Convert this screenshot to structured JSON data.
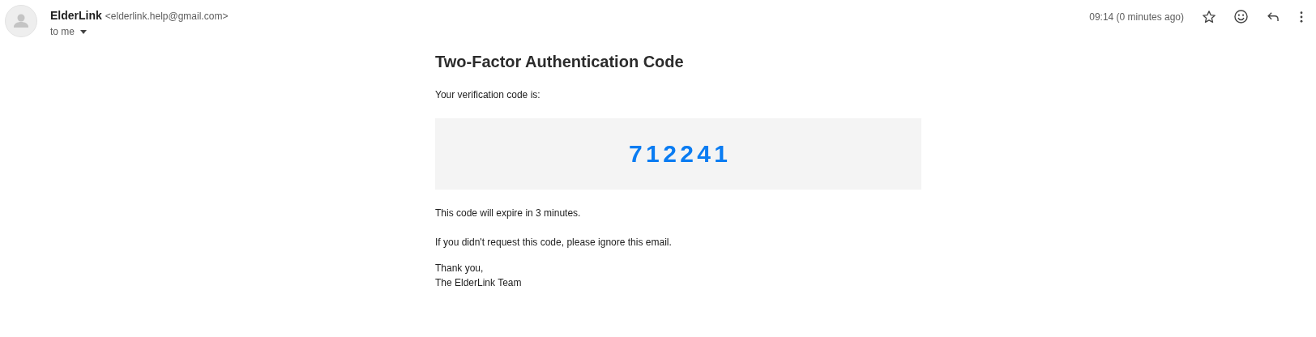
{
  "sender": {
    "name": "ElderLink",
    "address": "<elderlink.help@gmail.com>",
    "recipient": "to me"
  },
  "time": "09:14 (0 minutes ago)",
  "email": {
    "title": "Two-Factor Authentication Code",
    "intro": "Your verification code is:",
    "code": "7 1 2 2 4 1",
    "expiry": "This code will expire in 3 minutes.",
    "notice": "If you didn't request this code, please ignore this email.",
    "signoff": [
      "Thank you,",
      "The ElderLink Team"
    ]
  }
}
